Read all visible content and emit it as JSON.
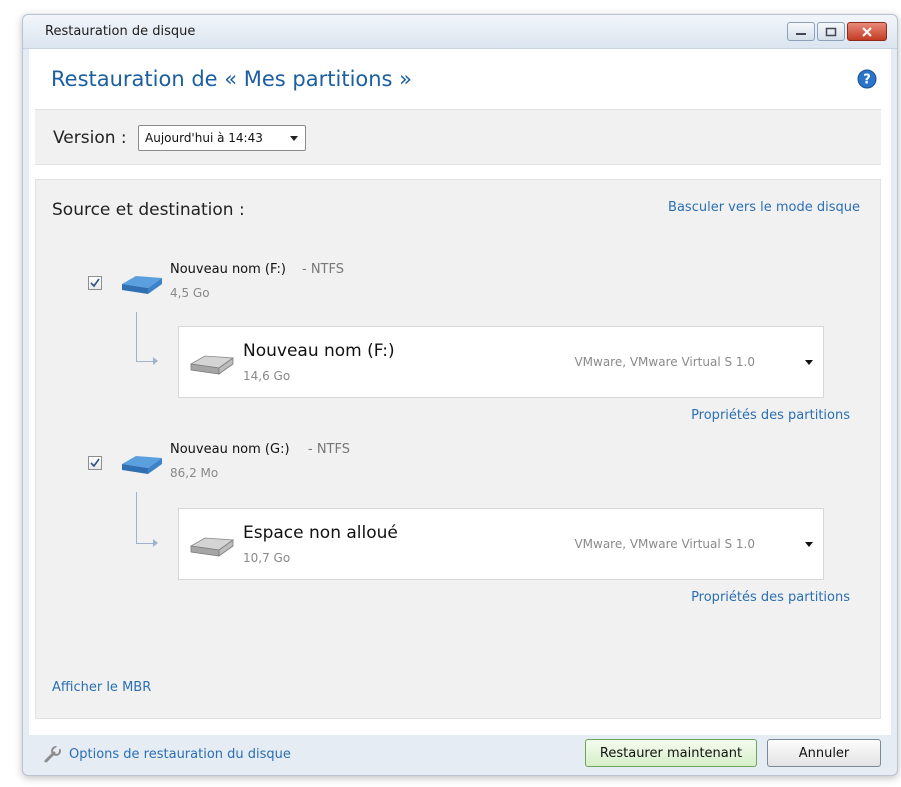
{
  "window": {
    "title": "Restauration de disque",
    "controls": [
      "minimize-icon",
      "maximize-icon",
      "close-icon"
    ]
  },
  "header": {
    "title": "Restauration de « Mes partitions  »",
    "help_icon": "help-icon"
  },
  "version": {
    "label": "Version :",
    "selected": "Aujourd'hui à 14:43"
  },
  "source_destination": {
    "title": "Source et destination :",
    "switch_link": "Basculer vers le mode disque",
    "partitions": [
      {
        "checked": true,
        "name": "Nouveau nom (F:)",
        "filesystem": "- NTFS",
        "size": "4,5 Go",
        "destination": {
          "name": "Nouveau nom (F:)",
          "size": "14,6 Go",
          "vendor": "VMware, VMware Virtual S 1.0"
        },
        "properties_link": "Propriétés des partitions"
      },
      {
        "checked": true,
        "name": "Nouveau nom (G:)",
        "filesystem": "- NTFS",
        "size": "86,2 Mo",
        "destination": {
          "name": "Espace non alloué",
          "size": "10,7 Go",
          "vendor": "VMware, VMware Virtual S 1.0"
        },
        "properties_link": "Propriétés des partitions"
      }
    ],
    "mbr_link": "Afficher le MBR"
  },
  "footer": {
    "options_link": "Options de restauration du disque",
    "restore_button": "Restaurer maintenant",
    "cancel_button": "Annuler"
  },
  "colors": {
    "link": "#2a6fb3",
    "header_title": "#1b5fa1",
    "primary_button": "#d6efc8"
  }
}
